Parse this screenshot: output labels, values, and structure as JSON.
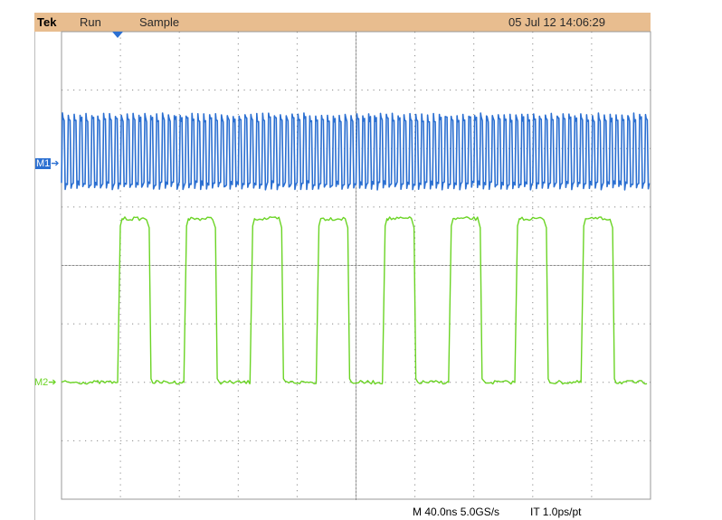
{
  "header": {
    "brand": "Tek",
    "acq_state": "Run",
    "acq_mode": "Sample",
    "datetime": "05 Jul 12 14:06:29"
  },
  "markers": {
    "m1": "M1",
    "m2": "M2"
  },
  "status": {
    "timebase": "M 40.0ns 5.0GS/s",
    "interp": "IT 1.0ps/pt"
  },
  "colors": {
    "m1": "#2b6fd1",
    "m2": "#6bd425",
    "header_bg": "#e8bd8f",
    "grid": "#8a8a8a",
    "trigger": "#2b6fd1"
  },
  "graticule": {
    "divisions_x": 10,
    "divisions_y": 8
  },
  "chart_data": {
    "type": "line",
    "series": [
      {
        "name": "M1",
        "pattern": "square",
        "cycles": 100,
        "high_div": 6.5,
        "low_div": 5.4
      },
      {
        "name": "M2",
        "pattern": "square",
        "pulses": 8,
        "high_div": 4.8,
        "low_div": 2.0,
        "duty": 0.45
      }
    ]
  }
}
